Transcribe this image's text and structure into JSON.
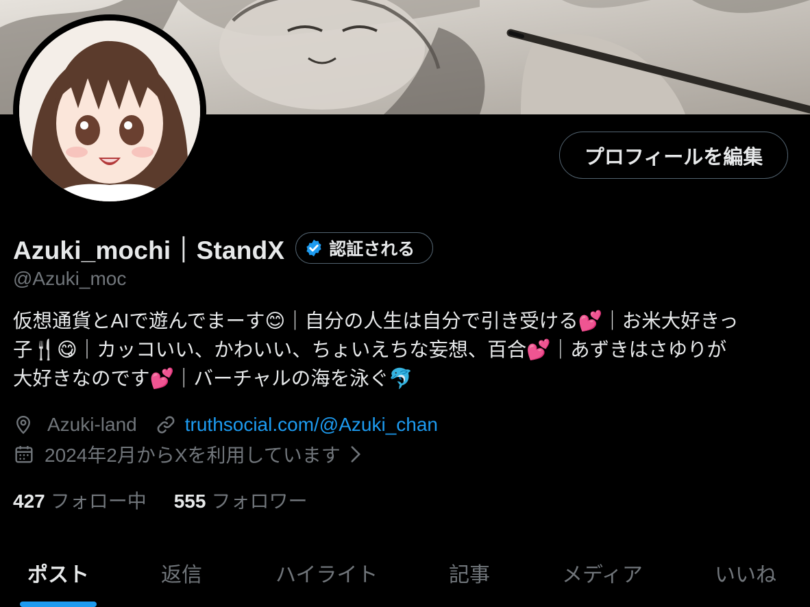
{
  "profile": {
    "display_name": "Azuki_mochi｜StandX",
    "verified_label": "認証される",
    "handle": "@Azuki_moc",
    "edit_button": "プロフィールを編集",
    "bio": [
      "仮想通貨とAIで遊んでまーす😊｜自分の人生は自分で引き受ける💕｜お米大好きっ",
      "子🍴😋｜カッコいい、かわいい、ちょいえちな妄想、百合💕｜あずきはさゆりが",
      "大好きなのです💕｜バーチャルの海を泳ぐ🐬"
    ],
    "location": "Azuki-land",
    "website": "truthsocial.com/@Azuki_chan",
    "joined": "2024年2月からXを利用しています",
    "following_count": "427",
    "following_label": "フォロー中",
    "followers_count": "555",
    "followers_label": "フォロワー"
  },
  "tabs": [
    {
      "label": "ポスト",
      "active": true
    },
    {
      "label": "返信",
      "active": false
    },
    {
      "label": "ハイライト",
      "active": false
    },
    {
      "label": "記事",
      "active": false
    },
    {
      "label": "メディア",
      "active": false
    },
    {
      "label": "いいね",
      "active": false
    }
  ],
  "colors": {
    "accent": "#1d9bf0",
    "muted_text": "#71767b",
    "primary_text": "#e7e9ea",
    "background": "#000000"
  },
  "icons": {
    "location": "location-pin-icon",
    "website": "link-icon",
    "joined": "calendar-icon",
    "verified": "verified-badge-icon"
  }
}
